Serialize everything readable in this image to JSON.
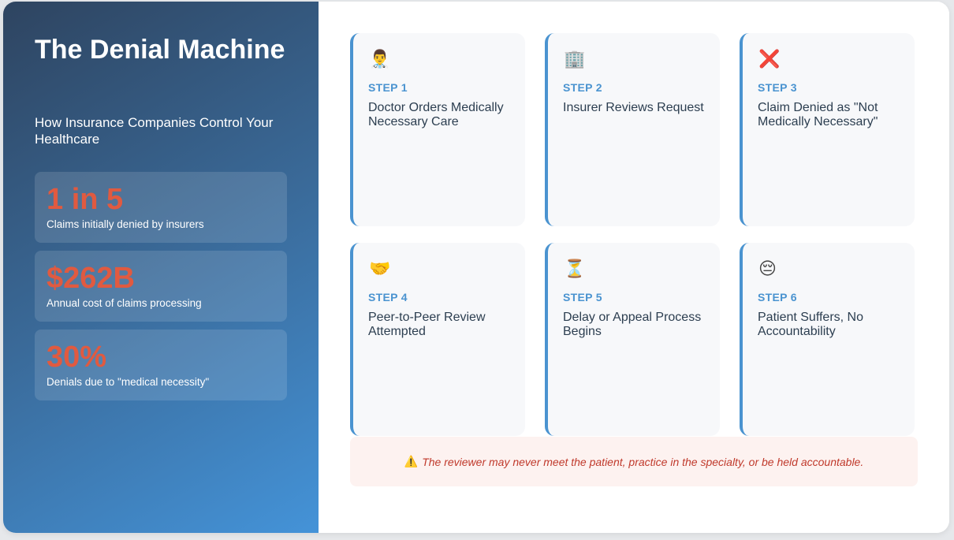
{
  "sidebar": {
    "title": "The Denial Machine",
    "subtitle": "How Insurance Companies Control Your Healthcare",
    "stats": [
      {
        "value": "1 in 5",
        "label": "Claims initially denied by insurers"
      },
      {
        "value": "$262B",
        "label": "Annual cost of claims processing"
      },
      {
        "value": "30%",
        "label": "Denials due to \"medical necessity\""
      }
    ]
  },
  "steps": [
    {
      "icon": "doctor-icon",
      "glyph": "👨‍⚕️",
      "label": "STEP 1",
      "text": "Doctor Orders Medically Necessary Care"
    },
    {
      "icon": "office-building-icon",
      "glyph": "🏢",
      "label": "STEP 2",
      "text": "Insurer Reviews Request"
    },
    {
      "icon": "cross-mark-icon",
      "glyph": "❌",
      "label": "STEP 3",
      "text": "Claim Denied as \"Not Medically Necessary\""
    },
    {
      "icon": "handshake-icon",
      "glyph": "🤝",
      "label": "STEP 4",
      "text": "Peer-to-Peer Review Attempted"
    },
    {
      "icon": "hourglass-icon",
      "glyph": "⏳",
      "label": "STEP 5",
      "text": "Delay or Appeal Process Begins"
    },
    {
      "icon": "pensive-face-icon",
      "glyph": "😔",
      "label": "STEP 6",
      "text": "Patient Suffers, No Accountability"
    }
  ],
  "warning": {
    "icon": "warning-icon",
    "glyph": "⚠️",
    "text": "The reviewer may never meet the patient, practice in the specialty, or be held accountable."
  },
  "colors": {
    "accent": "#4a93d0",
    "stat_value": "#e05a40",
    "warning_text": "#c0392b",
    "warning_bg": "#fdf2f0"
  }
}
